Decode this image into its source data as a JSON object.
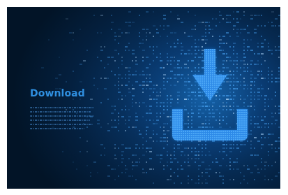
{
  "headline": "Download",
  "icon": "download-icon",
  "colors": {
    "background_dark": "#021427",
    "background_mid": "#083566",
    "accent": "#2f8fe0",
    "icon_fill": "#3f9cf0"
  }
}
